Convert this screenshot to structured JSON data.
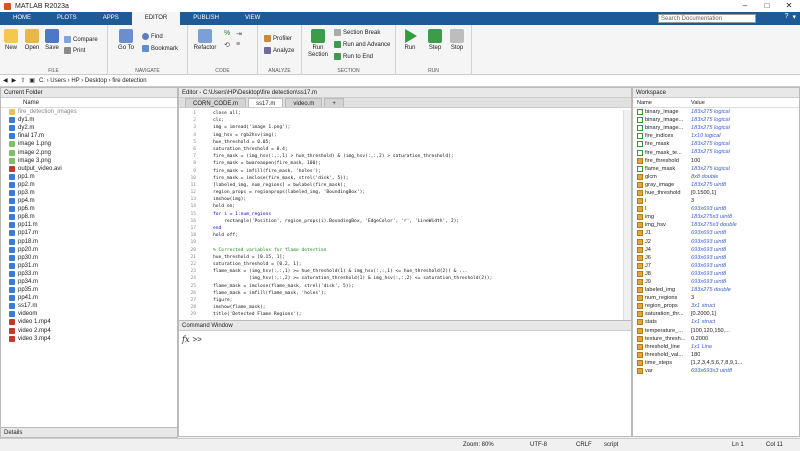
{
  "window": {
    "title": "MATLAB R2023a"
  },
  "tabs": [
    "HOME",
    "PLOTS",
    "APPS",
    "EDITOR",
    "PUBLISH",
    "VIEW"
  ],
  "active_tab": "EDITOR",
  "search": {
    "placeholder": "Search Documentation"
  },
  "toolstrip": {
    "file": {
      "label": "FILE",
      "new": "New",
      "open": "Open",
      "save": "Save",
      "compare": "Compare",
      "print": "Print"
    },
    "navigate": {
      "label": "NAVIGATE",
      "goto": "Go To",
      "find": "Find",
      "bookmark": "Bookmark"
    },
    "code": {
      "label": "CODE",
      "refactor": "Refactor"
    },
    "analyze": {
      "label": "ANALYZE",
      "profiler": "Profiler",
      "analyze": "Analyze"
    },
    "section": {
      "label": "SECTION",
      "run_section": "Run Section",
      "section_break": "Section Break",
      "run_and_advance": "Run and Advance",
      "run_to_end": "Run to End"
    },
    "run": {
      "label": "RUN",
      "run": "Run",
      "step": "Step",
      "stop": "Stop"
    }
  },
  "address": [
    "C:",
    "Users",
    "HP",
    "Desktop",
    "fire detection"
  ],
  "current_folder": {
    "title": "Current Folder",
    "col": "Name",
    "items": [
      {
        "name": "fire_detection_images",
        "type": "folder"
      },
      {
        "name": "dy1.m",
        "type": "m"
      },
      {
        "name": "dy2.m",
        "type": "m"
      },
      {
        "name": "final 17.m",
        "type": "m"
      },
      {
        "name": "image 1.png",
        "type": "img"
      },
      {
        "name": "image 2.png",
        "type": "img"
      },
      {
        "name": "image 3.png",
        "type": "img"
      },
      {
        "name": "output_video.avi",
        "type": "vid"
      },
      {
        "name": "pp1.m",
        "type": "m"
      },
      {
        "name": "pp2.m",
        "type": "m"
      },
      {
        "name": "pp3.m",
        "type": "m"
      },
      {
        "name": "pp4.m",
        "type": "m"
      },
      {
        "name": "pp6.m",
        "type": "m"
      },
      {
        "name": "pp8.m",
        "type": "m"
      },
      {
        "name": "pp11.m",
        "type": "m"
      },
      {
        "name": "pp17.m",
        "type": "m"
      },
      {
        "name": "pp18.m",
        "type": "m"
      },
      {
        "name": "pp20.m",
        "type": "m"
      },
      {
        "name": "pp30.m",
        "type": "m"
      },
      {
        "name": "pp31.m",
        "type": "m"
      },
      {
        "name": "pp33.m",
        "type": "m"
      },
      {
        "name": "pp34.m",
        "type": "m"
      },
      {
        "name": "pp35.m",
        "type": "m"
      },
      {
        "name": "pp41.m",
        "type": "m"
      },
      {
        "name": "ss17.m",
        "type": "m"
      },
      {
        "name": "videom",
        "type": "m"
      },
      {
        "name": "video 1.mp4",
        "type": "vid"
      },
      {
        "name": "video 2.mp4",
        "type": "vid"
      },
      {
        "name": "video 3.mp4",
        "type": "vid"
      }
    ],
    "details": "Details"
  },
  "editor": {
    "title": "Editor - C:\\Users\\HP\\Desktop\\fire detection\\ss17.m",
    "tabs": [
      "CORN_CODE.m",
      "ss17.m",
      "video.m"
    ],
    "active": "ss17.m",
    "lines": [
      {
        "n": "1",
        "t": "close all;",
        "c": ""
      },
      {
        "n": "2",
        "t": "clc;",
        "c": ""
      },
      {
        "n": "3",
        "t": "img = imread('image 1.png');",
        "c": ""
      },
      {
        "n": "4",
        "t": "img_hsv = rgb2hsv(img);",
        "c": ""
      },
      {
        "n": "5",
        "t": "hue_threshold = 0.05;",
        "c": ""
      },
      {
        "n": "6",
        "t": "saturation_threshold = 0.4;",
        "c": ""
      },
      {
        "n": "7",
        "t": "fire_mask = (img_hsv(:,:,1) > hue_threshold) & (img_hsv(:,:,2) > saturation_threshold);",
        "c": ""
      },
      {
        "n": "8",
        "t": "fire_mask = bwareaopen(fire_mask, 100);",
        "c": ""
      },
      {
        "n": "9",
        "t": "fire_mask = imfill(fire_mask, 'holes');",
        "c": ""
      },
      {
        "n": "10",
        "t": "fire_mask = imclose(fire_mask, strel('disk', 5));",
        "c": ""
      },
      {
        "n": "11",
        "t": "[labeled_img, num_regions] = bwlabel(fire_mask);",
        "c": ""
      },
      {
        "n": "12",
        "t": "region_props = regionprops(labeled_img, 'BoundingBox');",
        "c": ""
      },
      {
        "n": "13",
        "t": "imshow(img);",
        "c": ""
      },
      {
        "n": "14",
        "t": "hold on;",
        "c": ""
      },
      {
        "n": "15",
        "t": "for i = 1:num_regions",
        "c": "kw"
      },
      {
        "n": "16",
        "t": "    rectangle('Position', region_props(i).BoundingBox, 'EdgeColor', 'r', 'LineWidth', 2);",
        "c": ""
      },
      {
        "n": "17",
        "t": "end",
        "c": "kw"
      },
      {
        "n": "18",
        "t": "hold off;",
        "c": ""
      },
      {
        "n": "19",
        "t": "",
        "c": ""
      },
      {
        "n": "20",
        "t": "% Corrected variables for flame detection",
        "c": "cm"
      },
      {
        "n": "21",
        "t": "hue_threshold = [0.15, 1];",
        "c": ""
      },
      {
        "n": "22",
        "t": "saturation_threshold = [0.2, 1];",
        "c": ""
      },
      {
        "n": "23",
        "t": "flame_mask = (img_hsv(:,:,1) >= hue_threshold(1) & img_hsv(:,:,1) <= hue_threshold(2)) & ...",
        "c": ""
      },
      {
        "n": "24",
        "t": "             (img_hsv(:,:,2) >= saturation_threshold(1) & img_hsv(:,:,2) <= saturation_threshold(2));",
        "c": ""
      },
      {
        "n": "25",
        "t": "flame_mask = imclose(flame_mask, strel('disk', 5));",
        "c": ""
      },
      {
        "n": "26",
        "t": "flame_mask = imfill(flame_mask, 'holes');",
        "c": ""
      },
      {
        "n": "27",
        "t": "figure;",
        "c": ""
      },
      {
        "n": "28",
        "t": "imshow(flame_mask);",
        "c": ""
      },
      {
        "n": "29",
        "t": "title('Detected Flame Regions');",
        "c": ""
      }
    ]
  },
  "command_window": {
    "title": "Command Window",
    "fx": "fx",
    "prompt": ">>"
  },
  "workspace": {
    "title": "Workspace",
    "cols": [
      "Name",
      "Value"
    ],
    "vars": [
      {
        "name": "binary_image",
        "value": "183x275 logical",
        "it": true,
        "chk": true
      },
      {
        "name": "binary_image...",
        "value": "183x275 logical",
        "it": true,
        "chk": true
      },
      {
        "name": "binary_image...",
        "value": "183x275 logical",
        "it": true,
        "chk": true
      },
      {
        "name": "fire_indices",
        "value": "1x10 logical",
        "it": true,
        "chk": true
      },
      {
        "name": "fire_mask",
        "value": "183x275 logical",
        "it": true,
        "chk": true
      },
      {
        "name": "fire_mask_te...",
        "value": "183x275 logical",
        "it": true,
        "chk": true
      },
      {
        "name": "fire_threshold",
        "value": "100",
        "it": false
      },
      {
        "name": "flame_mask",
        "value": "183x275 logical",
        "it": true,
        "chk": true
      },
      {
        "name": "glcm",
        "value": "8x8 double",
        "it": true
      },
      {
        "name": "gray_image",
        "value": "183x275 uint8",
        "it": true
      },
      {
        "name": "hue_threshold",
        "value": "[0.1500,1]",
        "it": false
      },
      {
        "name": "i",
        "value": "3",
        "it": false
      },
      {
        "name": "I",
        "value": "693x693 uint8",
        "it": true
      },
      {
        "name": "img",
        "value": "183x275x3 uint8",
        "it": true
      },
      {
        "name": "img_hsv",
        "value": "183x275x3 double",
        "it": true
      },
      {
        "name": "J1",
        "value": "693x693 uint8",
        "it": true
      },
      {
        "name": "J2",
        "value": "693x693 uint8",
        "it": true
      },
      {
        "name": "J4",
        "value": "693x693 uint8",
        "it": true
      },
      {
        "name": "J6",
        "value": "693x693 uint8",
        "it": true
      },
      {
        "name": "J7",
        "value": "693x693 uint8",
        "it": true
      },
      {
        "name": "J8",
        "value": "693x693 uint8",
        "it": true
      },
      {
        "name": "J9",
        "value": "693x693 uint8",
        "it": true
      },
      {
        "name": "labeled_img",
        "value": "183x275 double",
        "it": true
      },
      {
        "name": "num_regions",
        "value": "3",
        "it": false
      },
      {
        "name": "region_props",
        "value": "3x1 struct",
        "it": true
      },
      {
        "name": "saturation_thr...",
        "value": "[0.2000,1]",
        "it": false
      },
      {
        "name": "stats",
        "value": "1x1 struct",
        "it": true
      },
      {
        "name": "temperature_...",
        "value": "[100,120,150,...",
        "it": false
      },
      {
        "name": "texture_thresh...",
        "value": "0.2000",
        "it": false
      },
      {
        "name": "threshold_line",
        "value": "1x1 Line",
        "it": true
      },
      {
        "name": "threshold_val...",
        "value": "180",
        "it": false
      },
      {
        "name": "time_steps",
        "value": "[1,2,3,4,5,6,7,8,9,1...",
        "it": false
      },
      {
        "name": "var",
        "value": "693x693x3 uint8",
        "it": true
      }
    ]
  },
  "status": {
    "zoom": "Zoom: 80%",
    "enc": "UTF-8",
    "eol": "CRLF",
    "type": "script",
    "ln": "Ln  1",
    "col": "Col  11"
  }
}
